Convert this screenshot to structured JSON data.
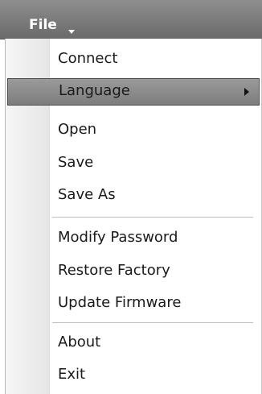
{
  "menubar": {
    "file_label": "File"
  },
  "menu": {
    "connect": "Connect",
    "language": "Language",
    "open": "Open",
    "save": "Save",
    "save_as": "Save As",
    "modify_password": "Modify Password",
    "restore_factory": "Restore Factory",
    "update_firmware": "Update Firmware",
    "about": "About",
    "exit": "Exit"
  },
  "icons": {
    "submenu_arrow": "triangle-right-icon",
    "dropdown_caret": "chevron-down-icon"
  }
}
